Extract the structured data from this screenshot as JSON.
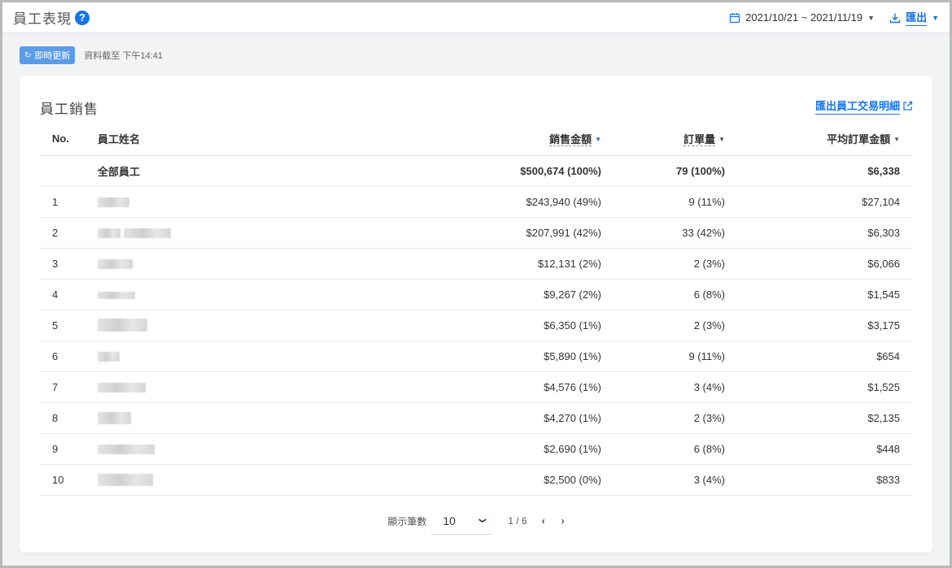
{
  "header": {
    "title": "員工表現",
    "date_range": "2021/10/21 ~ 2021/11/19",
    "export_label": "匯出"
  },
  "status": {
    "live_label": "即時更新",
    "updated_text": "資料截至 下午14:41"
  },
  "card": {
    "title": "員工銷售",
    "export_detail_label": "匯出員工交易明細"
  },
  "table": {
    "headers": {
      "no": "No.",
      "name": "員工姓名",
      "sales": "銷售金額",
      "orders": "訂單量",
      "avg": "平均訂單金額"
    },
    "total": {
      "name": "全部員工",
      "sales": "$500,674 (100%)",
      "orders": "79 (100%)",
      "avg": "$6,338"
    },
    "rows": [
      {
        "no": "1",
        "sales": "$243,940 (49%)",
        "orders": "9 (11%)",
        "avg": "$27,104"
      },
      {
        "no": "2",
        "sales": "$207,991 (42%)",
        "orders": "33 (42%)",
        "avg": "$6,303"
      },
      {
        "no": "3",
        "sales": "$12,131 (2%)",
        "orders": "2 (3%)",
        "avg": "$6,066"
      },
      {
        "no": "4",
        "sales": "$9,267 (2%)",
        "orders": "6 (8%)",
        "avg": "$1,545"
      },
      {
        "no": "5",
        "sales": "$6,350 (1%)",
        "orders": "2 (3%)",
        "avg": "$3,175"
      },
      {
        "no": "6",
        "sales": "$5,890 (1%)",
        "orders": "9 (11%)",
        "avg": "$654"
      },
      {
        "no": "7",
        "sales": "$4,576 (1%)",
        "orders": "3 (4%)",
        "avg": "$1,525"
      },
      {
        "no": "8",
        "sales": "$4,270 (1%)",
        "orders": "2 (3%)",
        "avg": "$2,135"
      },
      {
        "no": "9",
        "sales": "$2,690 (1%)",
        "orders": "6 (8%)",
        "avg": "$448"
      },
      {
        "no": "10",
        "sales": "$2,500 (0%)",
        "orders": "3 (4%)",
        "avg": "$833"
      }
    ]
  },
  "pagination": {
    "page_size_label": "顯示筆數",
    "page_size": "10",
    "page_info": "1 / 6"
  },
  "colors": {
    "accent": "#1a73e8",
    "badge": "#5b9cea"
  }
}
